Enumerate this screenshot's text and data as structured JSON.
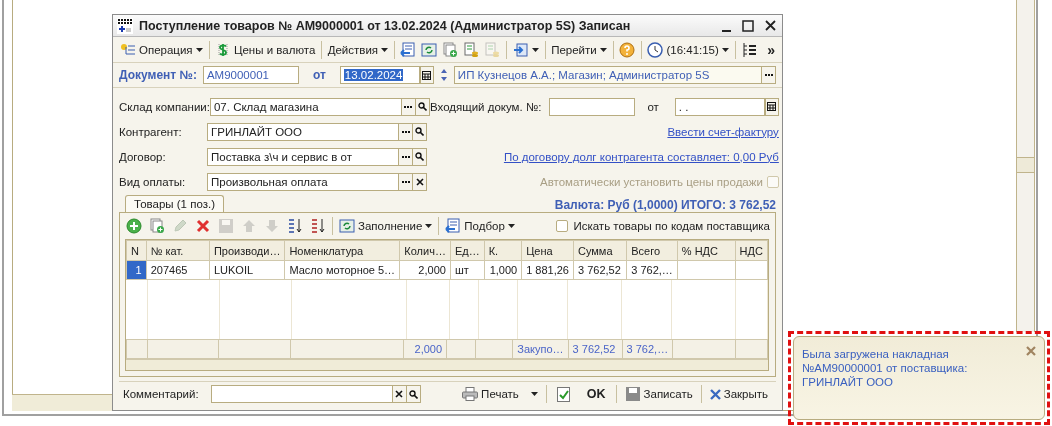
{
  "window": {
    "title": "Поступление товаров № АМ9000001 от 13.02.2024 (Администратор 5S) Записан"
  },
  "toolbar": [
    [
      {
        "kind": "menu",
        "label": "Операция"
      }
    ],
    [
      {
        "kind": "button",
        "label": "Цены и валюта"
      }
    ],
    [
      {
        "kind": "menu",
        "label": "Действия"
      }
    ],
    [
      {
        "kind": "icon",
        "disabled": false
      },
      {
        "kind": "icon",
        "disabled": false
      },
      {
        "kind": "icon",
        "disabled": false
      },
      {
        "kind": "icon",
        "disabled": false
      },
      {
        "kind": "icon",
        "disabled": true
      }
    ],
    [
      {
        "kind": "icon-menu",
        "disabled": false
      }
    ],
    [
      {
        "kind": "menu",
        "label": "Перейти"
      }
    ],
    [
      {
        "kind": "icon",
        "disabled": false
      }
    ],
    [
      {
        "kind": "menu",
        "label": "(16:41:15)"
      }
    ],
    [
      {
        "kind": "icon",
        "disabled": false
      }
    ],
    [
      {
        "kind": "more",
        "label": "»"
      }
    ]
  ],
  "document": {
    "label": "Документ №:",
    "number": "АМ9000001",
    "date_label": "от",
    "date": "13.02.2024",
    "organization": "ИП Кузнецов А.А.; Магазин; Администратор 5S"
  },
  "fields": [
    {
      "label": "Склад компании:",
      "value": "07. Склад магазина",
      "kind": "search"
    },
    {
      "label": "Контрагент:",
      "value": "ГРИНЛАЙТ ООО",
      "kind": "search"
    },
    {
      "label": "Договор:",
      "value": "Поставка з\\ч и сервис в  от",
      "kind": "search"
    },
    {
      "label": "Вид оплаты:",
      "value": "Произвольная оплата",
      "kind": "clear"
    }
  ],
  "incoming": {
    "label": "Входящий докум. №:",
    "date_label": "от",
    "date": " .  ."
  },
  "links": [
    "Ввести счет-фактуру",
    "По договору долг контрагента составляет: 0,00 Руб"
  ],
  "auto_prices": {
    "label": "Автоматически установить цены продажи",
    "checked": false,
    "disabled": true
  },
  "total": "Валюта: Руб (1,0000) ИТОГО: 3 762,52",
  "tabs": [
    {
      "label": "Товары (1 поз.)",
      "selected": true
    }
  ],
  "table_toolbar": {
    "icons": [
      {
        "disabled": false
      },
      {
        "disabled": false
      },
      {
        "disabled": true
      },
      {
        "disabled": false
      },
      {
        "disabled": true
      },
      {
        "disabled": true
      },
      {
        "disabled": true
      },
      {
        "disabled": false
      },
      {
        "disabled": false
      }
    ],
    "menus": [
      "Заполнение",
      "Подбор"
    ],
    "search_by_supplier_codes": {
      "label": "Искать товары по кодам поставщика",
      "checked": false
    }
  },
  "table": {
    "columns": [
      {
        "label": "N"
      },
      {
        "label": "№ кат."
      },
      {
        "label": "Производи…"
      },
      {
        "label": "Номенклатура"
      },
      {
        "label": "Колич…",
        "total": "2,000"
      },
      {
        "label": "Ед…"
      },
      {
        "label": "К."
      },
      {
        "label": "Цена",
        "total": "Закупо…"
      },
      {
        "label": "Сумма",
        "total": "3 762,52"
      },
      {
        "label": "Всего",
        "total": "3 762,…"
      },
      {
        "label": "% НДС"
      },
      {
        "label": "НДС"
      }
    ],
    "rows": [
      {
        "selected": true,
        "cells": [
          "1",
          "207465",
          "LUKOIL",
          "Масло моторное 5…",
          "2,000",
          "шт",
          "1,000",
          "1 881,26",
          "3 762,52",
          "3 762,…"
        ]
      }
    ]
  },
  "comment": {
    "label": "Комментарий:"
  },
  "buttons": [
    {
      "kind": "print",
      "label": "Печать"
    },
    {
      "kind": "ok",
      "label": "OK"
    },
    {
      "kind": "save",
      "label": "Записать"
    },
    {
      "kind": "close",
      "label": "Закрыть"
    }
  ],
  "notification": {
    "text": "Была загружена накладная №АМ90000001 от поставщика: ГРИНЛАЙТ ООО"
  }
}
